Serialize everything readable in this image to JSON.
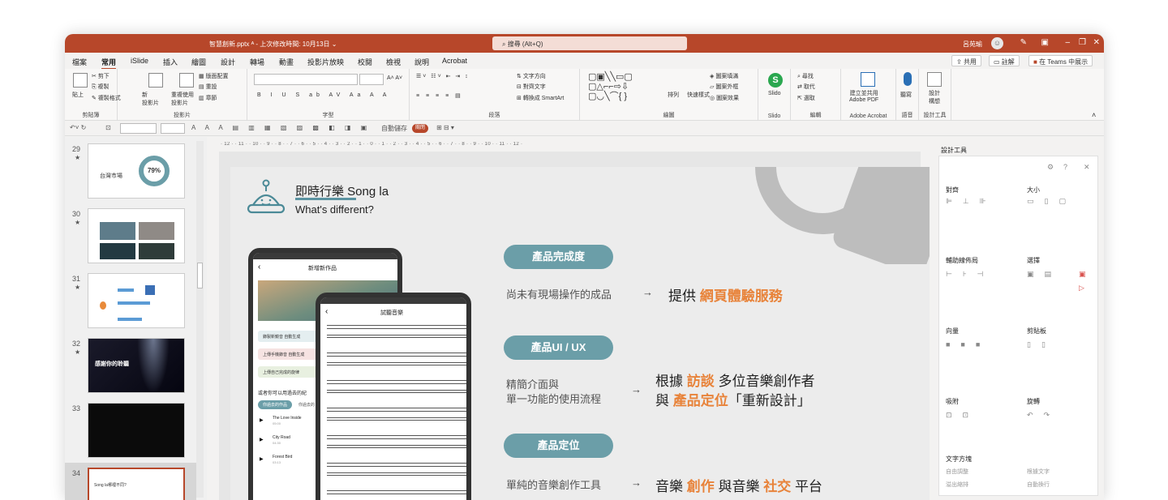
{
  "titlebar": {
    "doc": "智慧創新.pptx  ᴬ  -  上次修改時間: 10月13日 ⌄",
    "search": "搜尋 (Alt+Q)",
    "user": "呂苑瑜"
  },
  "menu": {
    "tabs": [
      "檔案",
      "常用",
      "iSlide",
      "插入",
      "繪圖",
      "設計",
      "轉場",
      "動畫",
      "投影片放映",
      "校閱",
      "檢視",
      "說明",
      "Acrobat"
    ],
    "share": "共用",
    "comment": "註解",
    "teams": "在 Teams 中展示"
  },
  "ribbon": {
    "clipboard": {
      "label": "剪貼簿",
      "paste": "貼上",
      "cut": "剪下",
      "copy": "複製",
      "format": "複製格式"
    },
    "slides": {
      "label": "投影片",
      "new": "新\n投影片",
      "reuse": "重複使用\n投影片",
      "layout": "版面配置",
      "reset": "重設",
      "section": "章節"
    },
    "font": {
      "label": "字型"
    },
    "paragraph": {
      "label": "段落",
      "textdir": "文字方向",
      "align": "對齊文字",
      "smartart": "轉換成 SmartArt"
    },
    "drawing": {
      "label": "繪圖",
      "arrange": "排列",
      "quick": "快速樣式",
      "fill": "圖案填滿",
      "outline": "圖案外框",
      "effect": "圖案效果"
    },
    "slido": {
      "label": "Slido",
      "btn": "Slido"
    },
    "editing": {
      "label": "編輯",
      "find": "尋找",
      "replace": "取代",
      "select": "選取"
    },
    "acrobat": {
      "label": "Adobe Acrobat",
      "btn": "建立並共用\nAdobe PDF"
    },
    "voice": {
      "label": "語音",
      "btn": "聽寫"
    },
    "designer": {
      "label": "設計工具",
      "btn": "設計\n構想"
    }
  },
  "qat": {
    "autosave": "自動儲存",
    "off": "關閉"
  },
  "ruler": "· 12 · · 11 · · 10 · · 9 · · 8 · · 7 · · 6 · · 5 · · 4 · · 3 · · 2 · · 1 · · 0 · · 1 · · 2 · · 3 · · 4 · · 5 · · 6 · · 7 · · 8 · · 9 · · 10 · · 11 · · 12 ·",
  "thumbs": [
    {
      "num": "29",
      "star": "★",
      "text": "台灣市場",
      "pct": "79%"
    },
    {
      "num": "30",
      "star": "★"
    },
    {
      "num": "31",
      "star": "★"
    },
    {
      "num": "32",
      "star": "★",
      "text": "感謝你的聆聽"
    },
    {
      "num": "33",
      "star": ""
    },
    {
      "num": "34",
      "star": "",
      "text": "Song la哪裡不同?"
    }
  ],
  "slide": {
    "title": "即時行樂 Song la",
    "subtitle": "What's different?",
    "rows": [
      {
        "pill": "產品完成度",
        "left": "尚未有現場操作的成品",
        "pre": "提供",
        "hl": "網頁體驗服務",
        "post": ""
      },
      {
        "pill": "產品UI / UX",
        "left1": "精簡介面與",
        "left2": "單一功能的使用流程",
        "l1pre": "根據",
        "l1hl": "訪談",
        "l1post": "多位音樂創作者",
        "l2pre": "與",
        "l2hl": "產品定位",
        "l2post": "「重新設計」"
      },
      {
        "pill": "產品定位",
        "left": "單純的音樂創作工具",
        "pre": "音樂",
        "hl": "創作",
        "mid": "與音樂",
        "hl2": "社交",
        "post": "平台"
      }
    ],
    "arrow": "→",
    "phone1": {
      "title": "新增新作品",
      "item1": "錄製新鏡音 自動生成",
      "item2": "上傳手機錄音 自動生成",
      "item3": "上傳自己完成的旋律",
      "q": "或者你可以用過去的紀",
      "tab1": "你過去的作品",
      "tab2": "你過去的",
      "songs": [
        {
          "name": "The Love Inside",
          "time": "05:00"
        },
        {
          "name": "City Road",
          "time": "04:30"
        },
        {
          "name": "Forest Bird",
          "time": "03:13"
        }
      ]
    },
    "phone2": {
      "title": "試聽音樂"
    }
  },
  "designer": {
    "title": "設計工具",
    "align": "對齊",
    "size": "大小",
    "guide": "輔助線佈局",
    "select": "選擇",
    "vector": "向量",
    "clipboard": "剪貼板",
    "snap": "吸附",
    "rotate": "旋轉",
    "textdir": "文字方塊",
    "opt1": "自由調整",
    "opt2": "根據文字",
    "opt3": "溢出縮排",
    "opt4": "自動換行"
  }
}
